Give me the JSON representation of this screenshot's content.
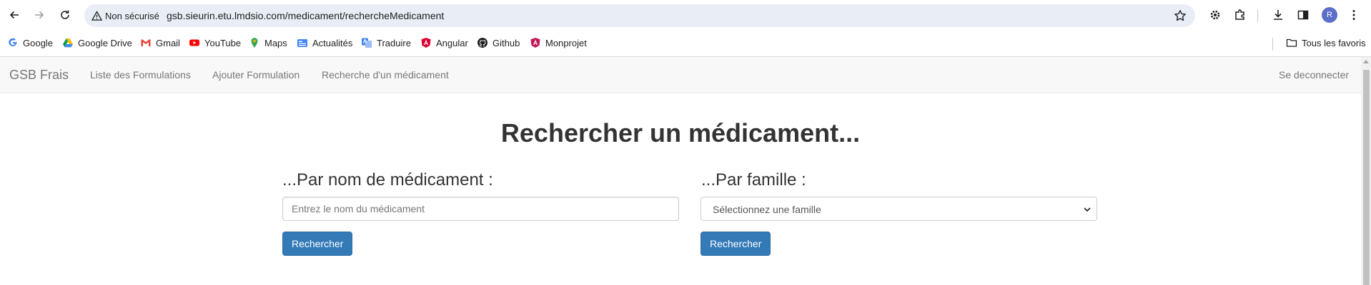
{
  "browser": {
    "security_label": "Non sécurisé",
    "url": "gsb.sieurin.etu.lmdsio.com/medicament/rechercheMedicament",
    "profile_initial": "R",
    "bookmarks": [
      {
        "label": "Google",
        "icon": "google-icon"
      },
      {
        "label": "Google Drive",
        "icon": "google-drive-icon"
      },
      {
        "label": "Gmail",
        "icon": "gmail-icon"
      },
      {
        "label": "YouTube",
        "icon": "youtube-icon"
      },
      {
        "label": "Maps",
        "icon": "maps-icon"
      },
      {
        "label": "Actualités",
        "icon": "news-icon"
      },
      {
        "label": "Traduire",
        "icon": "translate-icon"
      },
      {
        "label": "Angular",
        "icon": "angular-icon"
      },
      {
        "label": "Github",
        "icon": "github-icon"
      },
      {
        "label": "Monprojet",
        "icon": "monprojet-icon"
      }
    ],
    "all_bookmarks_label": "Tous les favoris"
  },
  "navbar": {
    "brand": "GSB Frais",
    "links": [
      "Liste des Formulations",
      "Ajouter Formulation",
      "Recherche d'un médicament"
    ],
    "logout": "Se deconnecter"
  },
  "main": {
    "title": "Rechercher un médicament...",
    "by_name": {
      "heading": "...Par nom de médicament :",
      "placeholder": "Entrez le nom du médicament",
      "button": "Rechercher"
    },
    "by_family": {
      "heading": "...Par famille :",
      "selected": "Sélectionnez une famille",
      "button": "Rechercher"
    }
  },
  "colors": {
    "primary_button": "#337ab7",
    "navbar_bg": "#f8f8f8",
    "omnibox_bg": "#e9eef6"
  }
}
